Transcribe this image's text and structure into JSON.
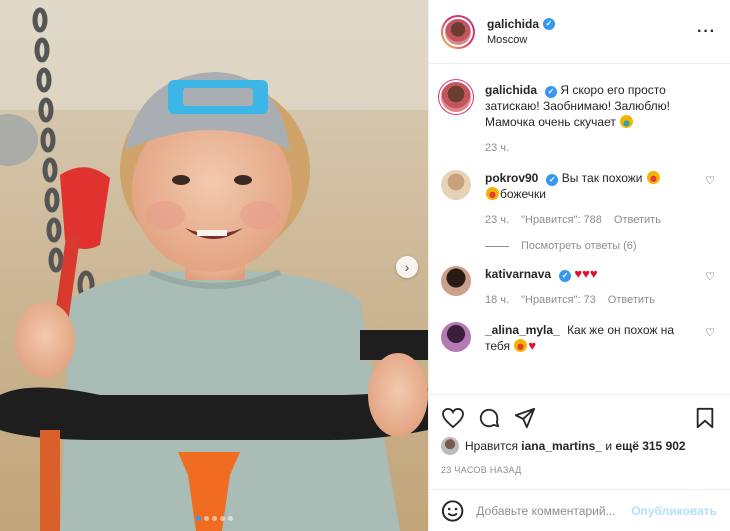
{
  "header": {
    "username": "galichida",
    "location": "Moscow",
    "more_icon": "more-dots-icon"
  },
  "caption": {
    "username": "galichida",
    "text": "Я скоро его просто затискаю! Заобнимаю! Залюблю! Мамочка очень скучает",
    "emoji": "crying-face",
    "time": "23 ч."
  },
  "comments": [
    {
      "username": "pokrov90",
      "verified": true,
      "text_a": "Вы так похожи",
      "text_b": "божечки",
      "time": "23 ч.",
      "likes": "\"Нравится\": 788",
      "reply": "Ответить",
      "view_replies": "Посмотреть ответы (6)"
    },
    {
      "username": "kativarnava",
      "verified": true,
      "text": "",
      "time": "18 ч.",
      "likes": "\"Нравится\": 73",
      "reply": "Ответить"
    },
    {
      "username": "_alina_myla_",
      "verified": false,
      "text": "Как же он похож на тебя"
    }
  ],
  "actions": {
    "liked_by_prefix": "Нравится",
    "liked_by_user": "iana_martins_",
    "liked_by_mid": "и",
    "liked_by_more": "ещё 315 902",
    "timestamp": "23 ЧАСОВ НАЗАД"
  },
  "comment_box": {
    "placeholder": "Добавьте комментарий...",
    "post_label": "Опубликовать"
  },
  "carousel": {
    "dots": 5,
    "active": 0
  },
  "colors": {
    "accent": "#3897f0",
    "heart_red": "#e0102f",
    "muted": "#8e8e8e"
  }
}
